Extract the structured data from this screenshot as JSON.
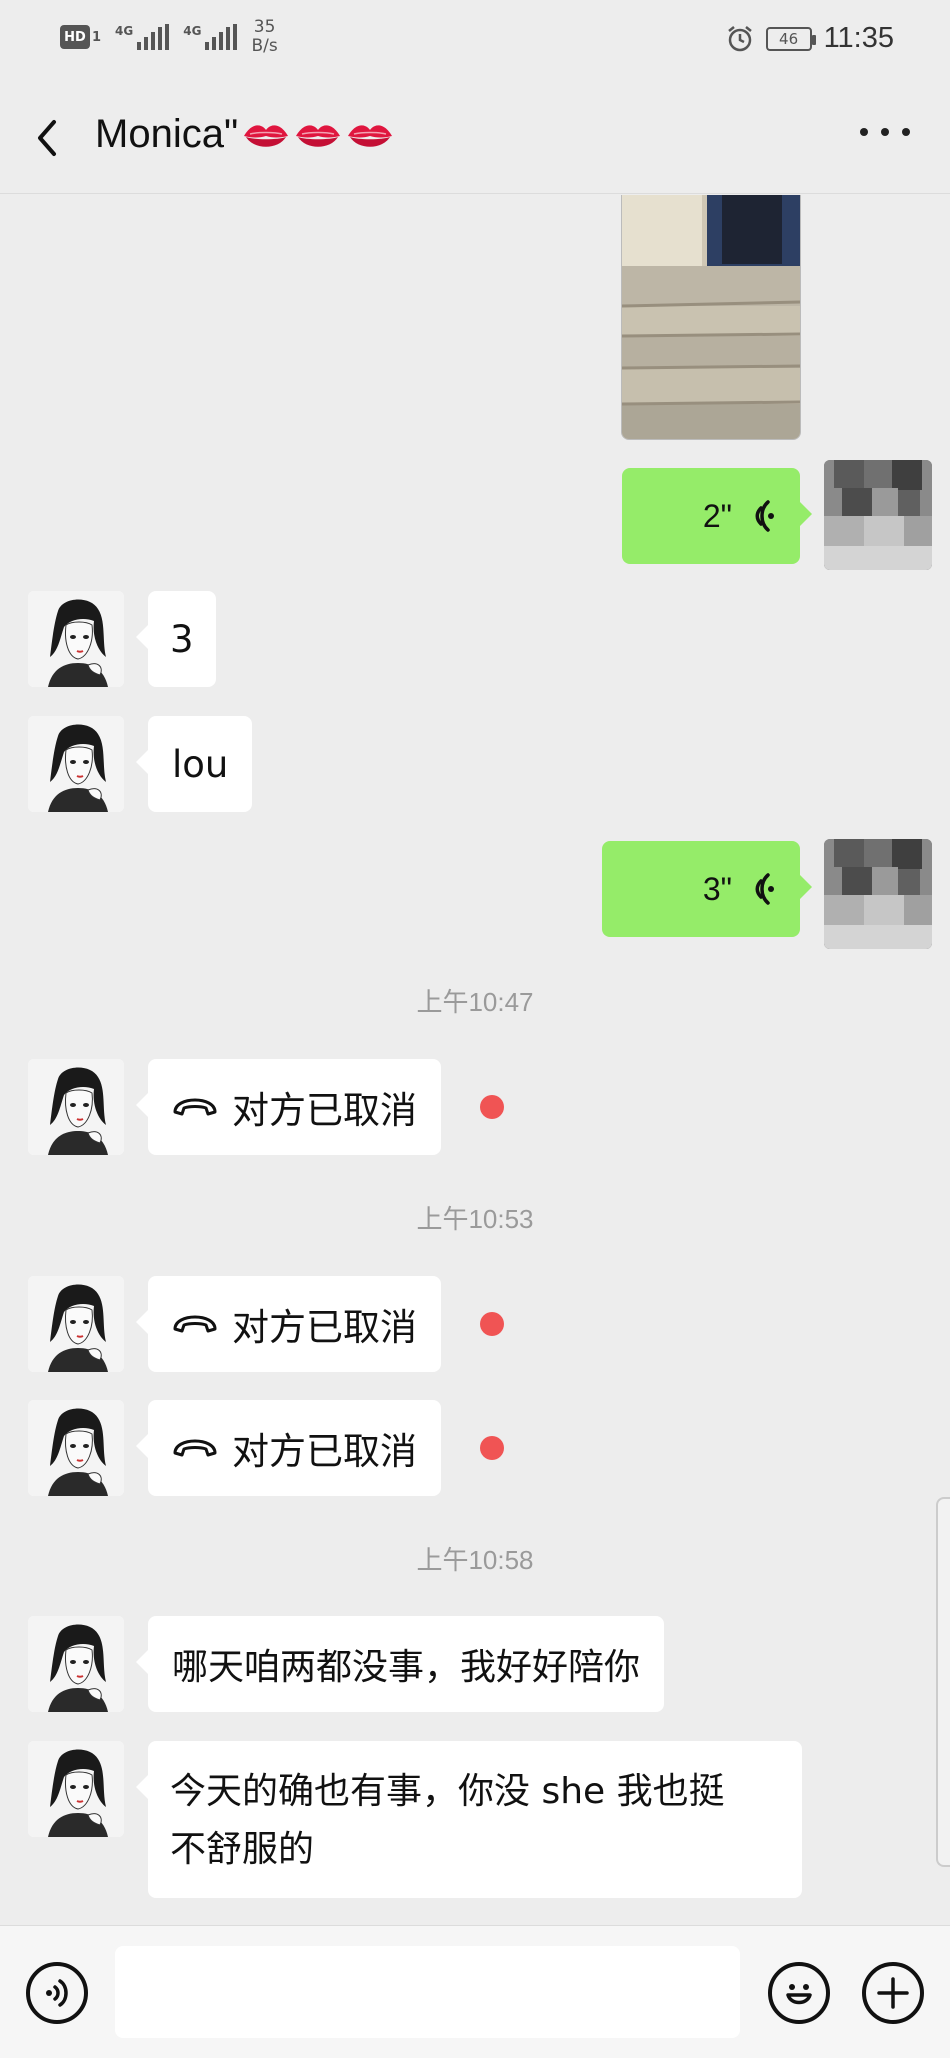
{
  "status_bar": {
    "hd_label": "HD",
    "hd_sub": "1",
    "network1": "4G",
    "network2": "4G",
    "speed_value": "35",
    "speed_unit": "B/s",
    "battery": "46",
    "time": "11:35"
  },
  "header": {
    "title": "Monica\"",
    "emoji": [
      "kiss-mark",
      "kiss-mark",
      "kiss-mark"
    ]
  },
  "messages": [
    {
      "type": "voice",
      "side": "right",
      "duration": "2\""
    },
    {
      "type": "text",
      "side": "left",
      "text": "3"
    },
    {
      "type": "text",
      "side": "left",
      "text": "lou"
    },
    {
      "type": "voice",
      "side": "right",
      "duration": "3\""
    },
    {
      "type": "timestamp",
      "text": "上午10:47"
    },
    {
      "type": "call",
      "side": "left",
      "text": "对方已取消",
      "unread": true
    },
    {
      "type": "timestamp",
      "text": "上午10:53"
    },
    {
      "type": "call",
      "side": "left",
      "text": "对方已取消",
      "unread": true
    },
    {
      "type": "call",
      "side": "left",
      "text": "对方已取消",
      "unread": true
    },
    {
      "type": "timestamp",
      "text": "上午10:58"
    },
    {
      "type": "text",
      "side": "left",
      "text": "哪天咱两都没事，我好好陪你"
    },
    {
      "type": "text",
      "side": "left",
      "lines": [
        "今天的确也有事，你没 she 我也挺",
        "不舒服的"
      ]
    }
  ],
  "input_bar": {
    "icons": [
      "voice-icon",
      "emoji-icon",
      "plus-icon"
    ],
    "value": ""
  },
  "colors": {
    "background": "#ededed",
    "own_bubble": "#95ec69",
    "other_bubble": "#ffffff",
    "unread_dot": "#f05454"
  }
}
